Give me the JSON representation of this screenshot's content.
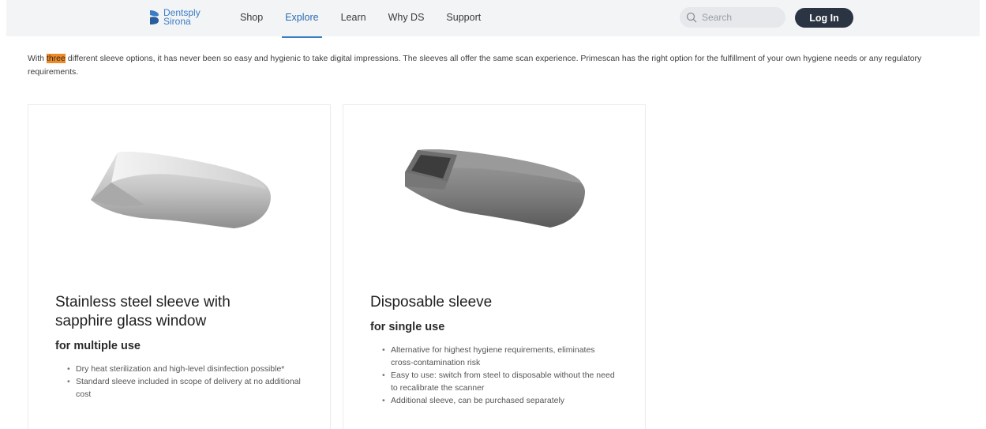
{
  "header": {
    "logo": {
      "line1": "Dentsply",
      "line2": "Sirona"
    },
    "nav": [
      {
        "label": "Shop",
        "active": false
      },
      {
        "label": "Explore",
        "active": true
      },
      {
        "label": "Learn",
        "active": false
      },
      {
        "label": "Why DS",
        "active": false
      },
      {
        "label": "Support",
        "active": false
      }
    ],
    "search_placeholder": "Search",
    "login_label": "Log In"
  },
  "intro": {
    "before": "With ",
    "highlight": "three",
    "after": " different sleeve options, it has never been so easy and hygienic to take digital impressions. The sleeves all offer the same scan experience. Primescan has the right option for the fulfillment of your own hygiene needs or any regulatory requirements."
  },
  "cards": [
    {
      "title_line1": "Stainless steel sleeve with",
      "title_line2": "sapphire glass window",
      "subtitle": "for multiple use",
      "bullets": [
        "Dry heat sterilization and high-level disinfection possible*",
        "Standard sleeve included in scope of delivery at no additional cost"
      ]
    },
    {
      "title_line1": "Disposable sleeve",
      "subtitle": "for single use",
      "bullets": [
        "Alternative for highest hygiene requirements, eliminates cross-contamination risk",
        "Easy to use: switch from steel to disposable without the need to recalibrate the scanner",
        "Additional sleeve, can be purchased separately"
      ]
    }
  ],
  "colors": {
    "brand_blue": "#3b7dc4",
    "login_bg": "#2a3442",
    "highlight": "#f08a24"
  }
}
